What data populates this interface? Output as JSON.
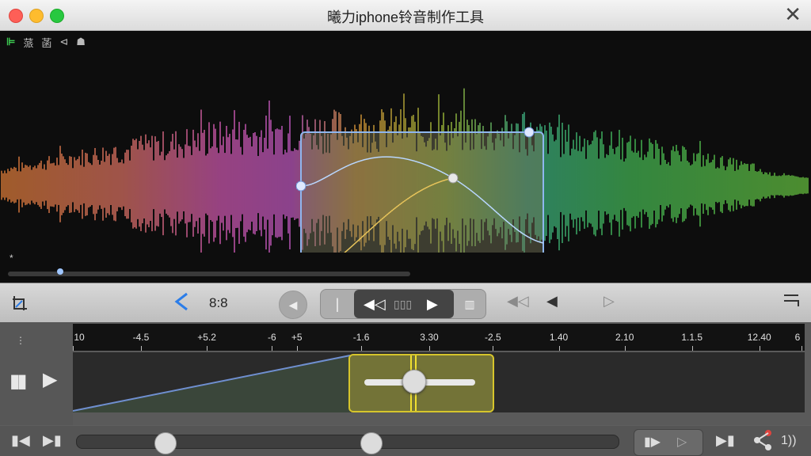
{
  "window": {
    "title": "曦力iphone铃音制作工具",
    "close_label": "✕"
  },
  "wave_toolbar": {
    "items": [
      "⊫",
      "蒎",
      "菡",
      "⊲",
      "☗"
    ]
  },
  "star_label": "*",
  "transport": {
    "time": "8:8",
    "segment_buttons": [
      "|",
      "◀◁",
      "▯▯▯",
      "▶",
      "▥"
    ],
    "back_icon": "back-arrow-icon"
  },
  "ruler": {
    "ticks": [
      {
        "label": "10",
        "pos": 0
      },
      {
        "label": "-4.5",
        "pos": 0.093
      },
      {
        "label": "+5.2",
        "pos": 0.183
      },
      {
        "label": "-6",
        "pos": 0.272
      },
      {
        "label": "+5",
        "pos": 0.306
      },
      {
        "label": "-1.6",
        "pos": 0.394
      },
      {
        "label": "3.30",
        "pos": 0.487
      },
      {
        "label": "-2.5",
        "pos": 0.574
      },
      {
        "label": "1.40",
        "pos": 0.664
      },
      {
        "label": "2.10",
        "pos": 0.754
      },
      {
        "label": "1.1.5",
        "pos": 0.846
      },
      {
        "label": "12.40",
        "pos": 0.938
      },
      {
        "label": "6",
        "pos": 0.996
      }
    ]
  },
  "bottom": {
    "volume_label": "1))"
  },
  "colors": {
    "accent": "#2b7de9",
    "selection": "#d6c52c"
  }
}
